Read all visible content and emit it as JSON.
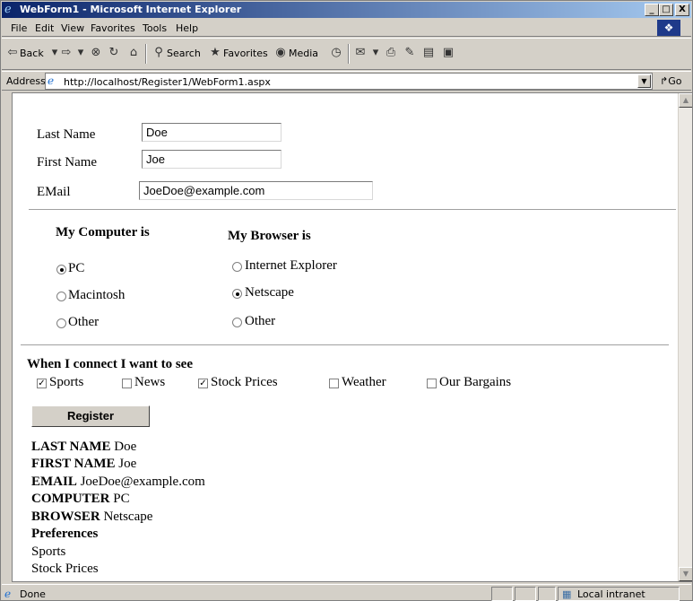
{
  "window": {
    "title": "WebForm1 - Microsoft Internet Explorer",
    "minimize": "_",
    "maximize": "□",
    "close": "X"
  },
  "menu": [
    "File",
    "Edit",
    "View",
    "Favorites",
    "Tools",
    "Help"
  ],
  "toolbar": {
    "back": "Back",
    "search": "Search",
    "favorites": "Favorites",
    "media": "Media"
  },
  "address": {
    "label": "Address",
    "url": "http://localhost/Register1/WebForm1.aspx",
    "go": "Go"
  },
  "form": {
    "last_name_label": "Last Name",
    "last_name_value": "Doe",
    "first_name_label": "First Name",
    "first_name_value": "Joe",
    "email_label": "EMail",
    "email_value": "JoeDoe@example.com",
    "computer_heading": "My Computer is",
    "computer_options": [
      {
        "label": "PC",
        "selected": true
      },
      {
        "label": "Macintosh",
        "selected": false
      },
      {
        "label": "Other",
        "selected": false
      }
    ],
    "browser_heading": "My Browser is",
    "browser_options": [
      {
        "label": "Internet Explorer",
        "selected": false
      },
      {
        "label": "Netscape",
        "selected": true
      },
      {
        "label": "Other",
        "selected": false
      }
    ],
    "connect_heading": "When I connect I want to see",
    "checkboxes": [
      {
        "label": "Sports",
        "checked": true
      },
      {
        "label": "News",
        "checked": false
      },
      {
        "label": "Stock Prices",
        "checked": true
      },
      {
        "label": "Weather",
        "checked": false
      },
      {
        "label": "Our Bargains",
        "checked": false
      }
    ],
    "register_button": "Register"
  },
  "output": {
    "last_name_key": "LAST NAME",
    "last_name_val": "Doe",
    "first_name_key": "FIRST NAME",
    "first_name_val": "Joe",
    "email_key": "EMAIL",
    "email_val": "JoeDoe@example.com",
    "computer_key": "COMPUTER",
    "computer_val": "PC",
    "browser_key": "BROWSER",
    "browser_val": "Netscape",
    "preferences_heading": "Preferences",
    "preferences": [
      "Sports",
      "Stock Prices"
    ]
  },
  "status": {
    "text": "Done",
    "zone": "Local intranet"
  }
}
